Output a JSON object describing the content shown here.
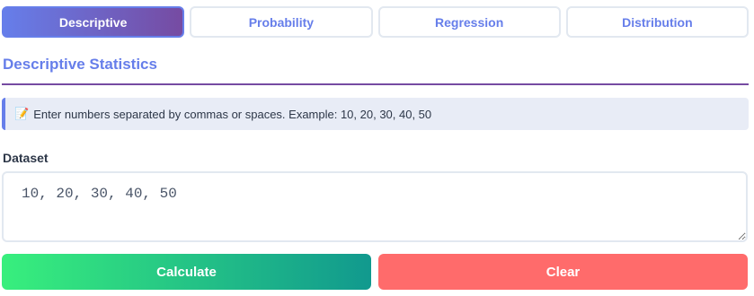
{
  "tabs": [
    {
      "label": "Descriptive",
      "active": true
    },
    {
      "label": "Probability",
      "active": false
    },
    {
      "label": "Regression",
      "active": false
    },
    {
      "label": "Distribution",
      "active": false
    }
  ],
  "section": {
    "title": "Descriptive Statistics"
  },
  "hint": {
    "icon": "memo-icon",
    "text": "Enter numbers separated by commas or spaces. Example: 10, 20, 30, 40, 50"
  },
  "dataset": {
    "label": "Dataset",
    "value": "10, 20, 30, 40, 50"
  },
  "actions": {
    "calculate_label": "Calculate",
    "clear_label": "Clear"
  },
  "colors": {
    "accent": "#667eea",
    "accent_dark": "#764ba2",
    "calculate_start": "#38ef7d",
    "calculate_end": "#11998e",
    "clear": "#ff6b6b",
    "hint_bg": "#e8ecf6"
  }
}
